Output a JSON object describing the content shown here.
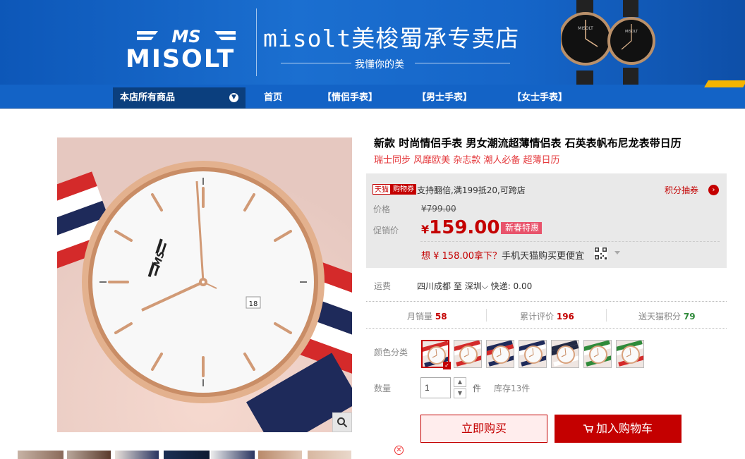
{
  "header": {
    "brand_word": "MISOLT",
    "brand_mark": "MS",
    "store_name": "misolt美梭蜀承专卖店",
    "slogan": "我懂你的美",
    "watch_face_text": "MISOLT"
  },
  "nav": {
    "category_label": "本店所有商品",
    "items": [
      "首页",
      "【情侣手表】",
      "【男士手表】",
      "【女士手表】"
    ]
  },
  "product": {
    "title": "新款 时尚情侣手表 男女潮流超薄情侣表 石英表帆布尼龙表带日历",
    "subtitle": "瑞士同步 风靡欧美 杂志款 潮人必备 超薄日历",
    "tmall_tag": "天猫",
    "coupon_tag": "购物券",
    "promo_text": "支持翻倍,满199抵20,可跨店",
    "jifen_label": "积分抽券",
    "price_label": "价格",
    "old_price": "¥799.00",
    "promo_price_label": "促销价",
    "currency": "¥",
    "new_price": "159.00",
    "promo_badge": "新春特惠",
    "mobile_promo_prefix": "想 ¥ 158.00拿下？",
    "mobile_promo_rest": "手机天猫购买更便宜",
    "date_window": "18"
  },
  "shipping": {
    "label": "运费",
    "from": "四川成都",
    "to_word": "至",
    "dest": "深圳",
    "method": "快递: 0.00"
  },
  "stats": {
    "monthly_label": "月销量",
    "monthly_value": "58",
    "reviews_label": "累计评价",
    "reviews_value": "196",
    "points_label": "送天猫积分",
    "points_value": "79"
  },
  "options": {
    "color_label": "颜色分类",
    "swatches": [
      {
        "name": "red-white-blue",
        "colors": [
          "#d42a2a",
          "#ffffff",
          "#1e2a5a"
        ]
      },
      {
        "name": "red-white",
        "colors": [
          "#d42a2a",
          "#ffffff",
          "#d42a2a"
        ]
      },
      {
        "name": "navy-red",
        "colors": [
          "#1e2a5a",
          "#d42a2a",
          "#1e2a5a"
        ]
      },
      {
        "name": "blue-white",
        "colors": [
          "#1e2a5a",
          "#ffffff",
          "#1e2a5a"
        ]
      },
      {
        "name": "navy",
        "colors": [
          "#222a44",
          "#222a44",
          "#ffffff"
        ]
      },
      {
        "name": "green-white",
        "colors": [
          "#2f8a3a",
          "#ffffff",
          "#2f8a3a"
        ]
      },
      {
        "name": "green-red",
        "colors": [
          "#2f8a3a",
          "#ffffff",
          "#d42a2a"
        ]
      }
    ],
    "quantity_label": "数量",
    "quantity_value": "1",
    "unit": "件",
    "stock": "库存13件"
  },
  "actions": {
    "buy_now": "立即购买",
    "add_to_cart": "加入购物车"
  },
  "colors": {
    "banner_blue": "#1565c8",
    "tmall_red": "#c40000",
    "promo_pink": "#e8536b"
  }
}
